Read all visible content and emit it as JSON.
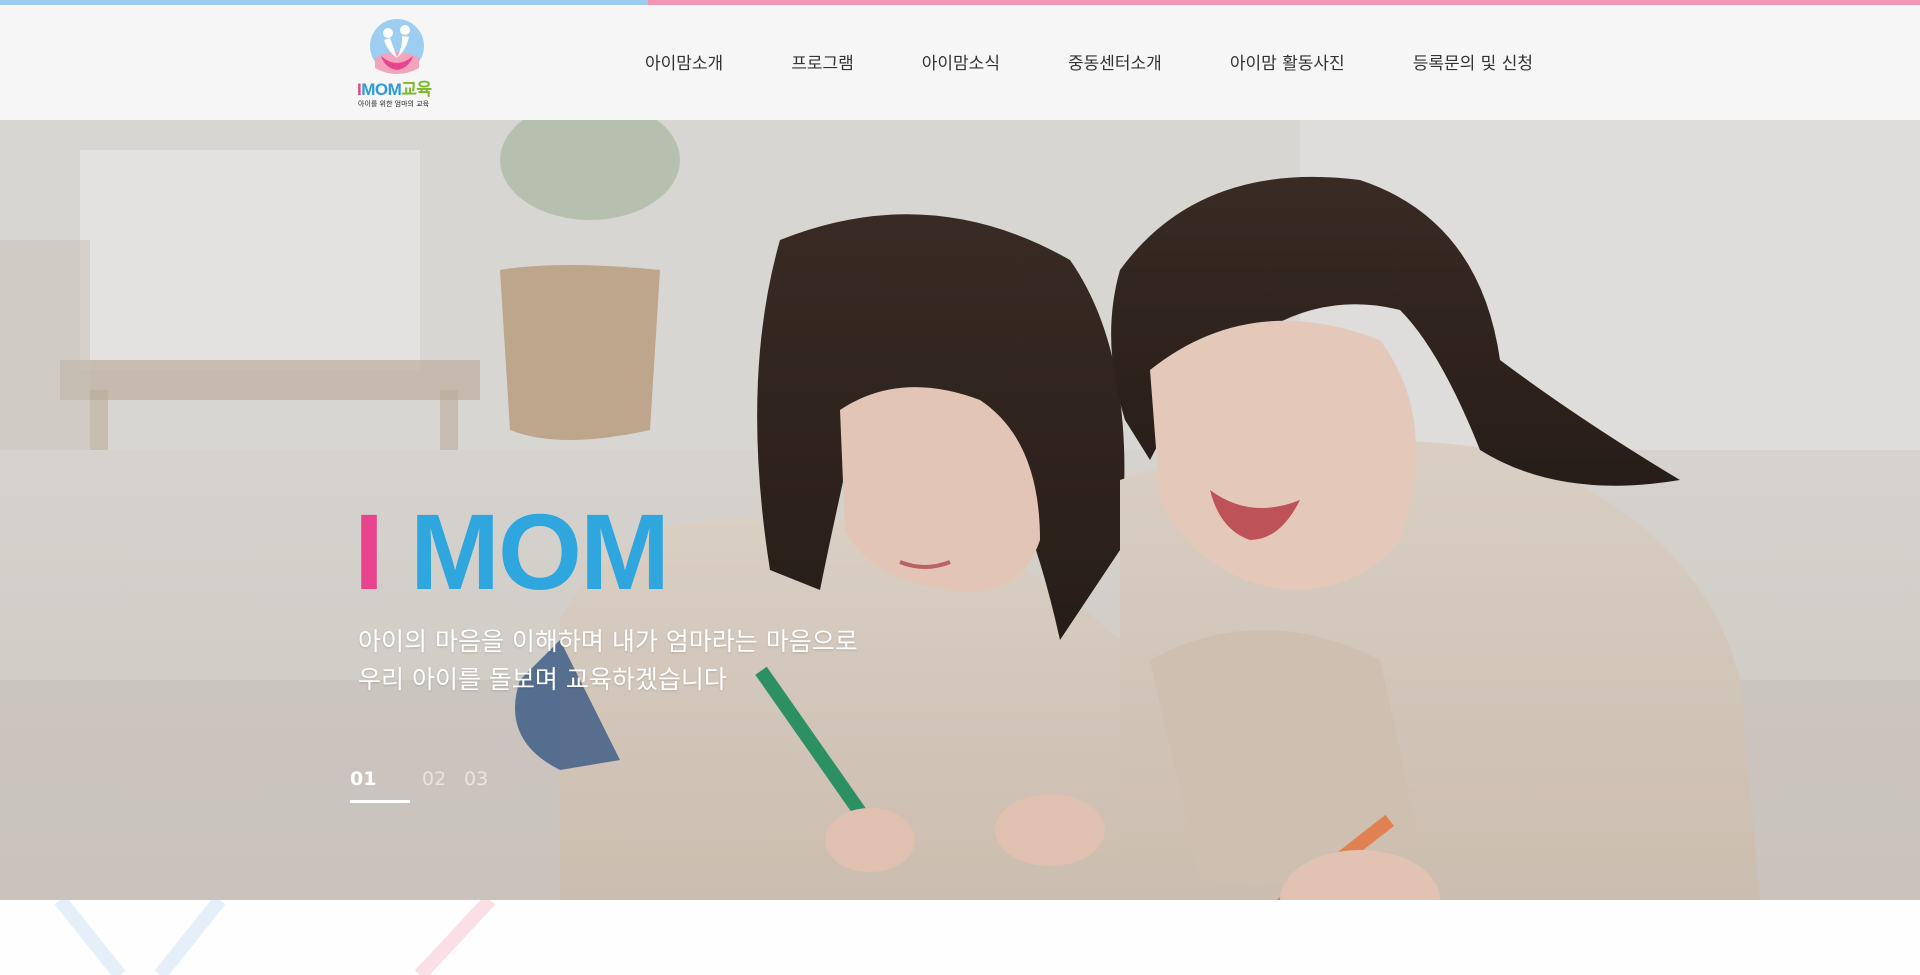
{
  "colors": {
    "strip_blue": "#9dccf2",
    "strip_pink": "#f197b4",
    "header_bg": "#f6f6f6",
    "brand_pink": "#e8438d",
    "brand_blue": "#2fa6de",
    "brand_green": "#7cb829"
  },
  "logo": {
    "i": "I",
    "mom": "MOM",
    "edu": "교육",
    "tagline": "아이를 위한 엄마의 교육"
  },
  "nav": {
    "items": [
      {
        "label": "아이맘소개"
      },
      {
        "label": "프로그램"
      },
      {
        "label": "아이맘소식"
      },
      {
        "label": "중동센터소개"
      },
      {
        "label": "아이맘 활동사진"
      },
      {
        "label": "등록문의 및 신청"
      }
    ]
  },
  "hero": {
    "title_i": "I",
    "title_mom": "MOM",
    "subtitle_line1": "아이의 마음을 이해하며 내가 엄마라는 마음으로",
    "subtitle_line2": "우리 아이를 돌보며 교육하겠습니다",
    "image_icon": "mother-daughter-drawing-photo"
  },
  "slides": {
    "active": "01",
    "second": "02",
    "third": "03",
    "current_index": 1,
    "total": 3
  }
}
